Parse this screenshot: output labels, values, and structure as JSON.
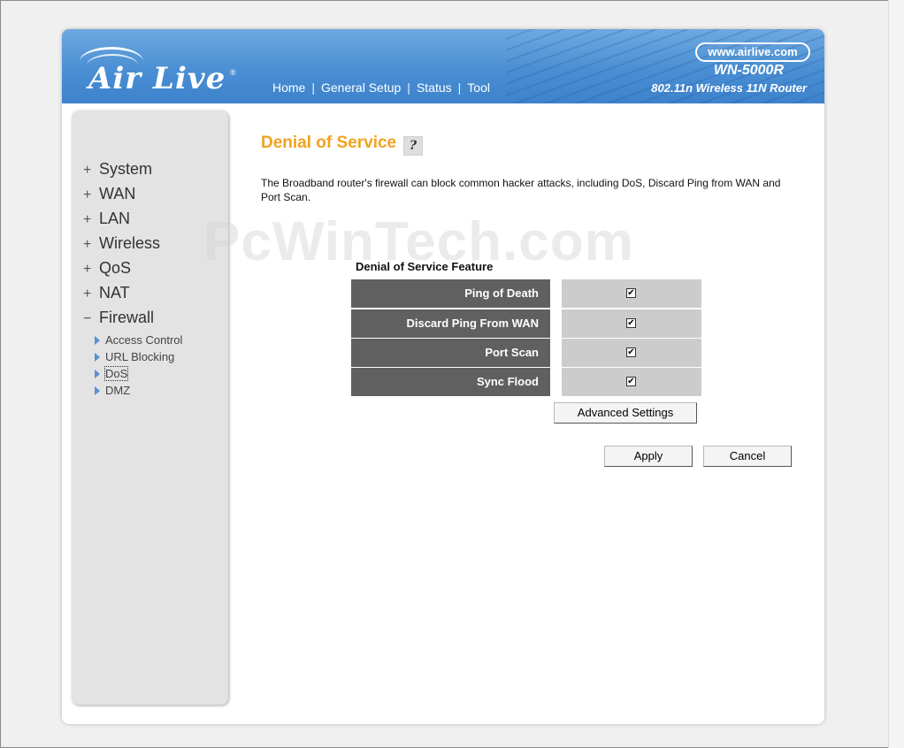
{
  "header": {
    "logo_text": "Air Live",
    "reg_mark": "®",
    "url": "www.airlive.com",
    "model": "WN-5000R",
    "subtitle": "802.11n Wireless 11N Router",
    "nav": [
      {
        "label": "Home"
      },
      {
        "label": "General Setup"
      },
      {
        "label": "Status"
      },
      {
        "label": "Tool"
      }
    ],
    "nav_separator": "|",
    "accent_color": "#4a8fd4"
  },
  "sidebar": {
    "items": [
      {
        "sign": "+",
        "label": "System"
      },
      {
        "sign": "+",
        "label": "WAN"
      },
      {
        "sign": "+",
        "label": "LAN"
      },
      {
        "sign": "+",
        "label": "Wireless"
      },
      {
        "sign": "+",
        "label": "QoS"
      },
      {
        "sign": "+",
        "label": "NAT"
      },
      {
        "sign": "−",
        "label": "Firewall"
      }
    ],
    "firewall_subitems": [
      {
        "label": "Access Control"
      },
      {
        "label": "URL Blocking"
      },
      {
        "label": "DoS"
      },
      {
        "label": "DMZ"
      }
    ]
  },
  "watermark": "PcWinTech.com",
  "main": {
    "title": "Denial of Service",
    "title_color": "#f0a222",
    "help_icon_glyph": "?",
    "description": "The Broadband router's firewall can block common hacker attacks, including DoS, Discard Ping from WAN and Port Scan.",
    "feature_heading": "Denial of Service Feature",
    "features": [
      {
        "label": "Ping of Death",
        "checked": true,
        "mark": "✔"
      },
      {
        "label": "Discard Ping From WAN",
        "checked": true,
        "mark": "✔"
      },
      {
        "label": "Port Scan",
        "checked": true,
        "mark": "✔"
      },
      {
        "label": "Sync Flood",
        "checked": true,
        "mark": "✔"
      }
    ],
    "advanced_button": "Advanced Settings",
    "apply_button": "Apply",
    "cancel_button": "Cancel"
  }
}
